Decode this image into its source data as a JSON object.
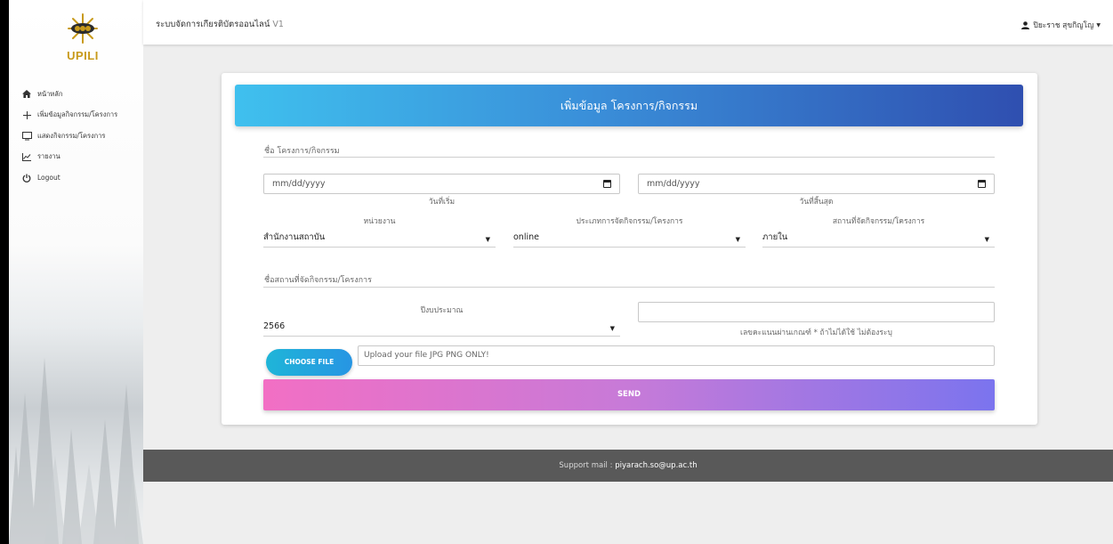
{
  "app": {
    "title": "ระบบจัดการเกียรติบัตรออนไลน์",
    "version": "V1",
    "logo_text": "UPILI"
  },
  "user": {
    "name": "ปิยะราช สุขกิญโญ"
  },
  "sidebar": {
    "items": [
      {
        "icon": "home-icon",
        "label": "หน้าหลัก"
      },
      {
        "icon": "plus-icon",
        "label": "เพิ่มข้อมูลกิจกรรม/โครงการ"
      },
      {
        "icon": "monitor-icon",
        "label": "แสดงกิจกรรม/โครงการ"
      },
      {
        "icon": "chart-icon",
        "label": "รายงาน"
      },
      {
        "icon": "power-icon",
        "label": "Logout"
      }
    ]
  },
  "form": {
    "header": "เพิ่มข้อมูล โครงการ/กิจกรรม",
    "project_name_placeholder": "ชื่อ โครงการ/กิจกรรม",
    "start_date": {
      "placeholder": "mm/dd/yyyy",
      "caption": "วันที่เริ่ม"
    },
    "end_date": {
      "placeholder": "mm/dd/yyyy",
      "caption": "วันที่สิ้นสุด"
    },
    "unit": {
      "label": "หน่วยงาน",
      "value": "สำนักงานสถาบัน"
    },
    "type": {
      "label": "ประเภทการจัดกิจกรรม/โครงการ",
      "value": "online"
    },
    "location_type": {
      "label": "สถานที่จัดกิจกรรม/โครงการ",
      "value": "ภายใน"
    },
    "venue_placeholder": "ชื่อสถานที่จัดกิจกรรม/โครงการ",
    "budget_year": {
      "label": "ปีงบประมาณ",
      "value": "2566"
    },
    "passing_score": {
      "value": "",
      "caption": "เลขคะแนนผ่านเกณฑ์ * ถ้าไม่ได้ใช้ ไม่ต้องระบุ"
    },
    "choose_file_label": "CHOOSE FILE",
    "file_placeholder": "Upload your file JPG PNG ONLY!",
    "send_label": "SEND"
  },
  "footer": {
    "prefix": "Support mail :",
    "email": "piyarach.so@up.ac.th"
  },
  "colors": {
    "header_gradient_start": "#3fc0ee",
    "header_gradient_end": "#2f4fb0",
    "send_gradient_start": "#f26fc4",
    "send_gradient_end": "#7b74ee",
    "choose_button": "#1fb5d8",
    "footer_bg": "#595959"
  }
}
